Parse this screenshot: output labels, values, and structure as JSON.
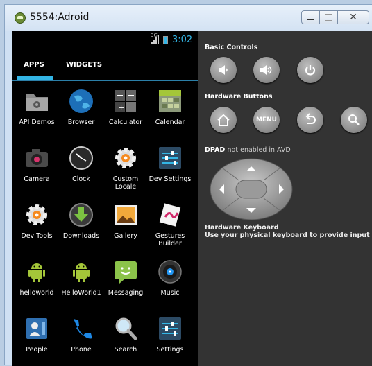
{
  "window": {
    "title": "5554:Adroid",
    "title_icon": "android-emulator-icon"
  },
  "statusbar": {
    "network": "3G",
    "time": "3:02",
    "accent": "#33b5e5"
  },
  "tabs": {
    "apps": "APPS",
    "widgets": "WIDGETS"
  },
  "apps": [
    {
      "label": "API Demos",
      "icon": "folder-gear-icon"
    },
    {
      "label": "Browser",
      "icon": "globe-icon"
    },
    {
      "label": "Calculator",
      "icon": "calculator-icon"
    },
    {
      "label": "Calendar",
      "icon": "calendar-icon"
    },
    {
      "label": "Camera",
      "icon": "camera-icon"
    },
    {
      "label": "Clock",
      "icon": "clock-icon"
    },
    {
      "label": "Custom Locale",
      "icon": "gear-icon"
    },
    {
      "label": "Dev Settings",
      "icon": "sliders-icon"
    },
    {
      "label": "Dev Tools",
      "icon": "gear-icon"
    },
    {
      "label": "Downloads",
      "icon": "download-icon"
    },
    {
      "label": "Gallery",
      "icon": "gallery-icon"
    },
    {
      "label": "Gestures Builder",
      "icon": "gestures-icon"
    },
    {
      "label": "helloworld",
      "icon": "android-icon"
    },
    {
      "label": "HelloWorld1",
      "icon": "android-icon"
    },
    {
      "label": "Messaging",
      "icon": "message-icon"
    },
    {
      "label": "Music",
      "icon": "music-icon"
    },
    {
      "label": "People",
      "icon": "contacts-icon"
    },
    {
      "label": "Phone",
      "icon": "phone-icon"
    },
    {
      "label": "Search",
      "icon": "search-icon"
    },
    {
      "label": "Settings",
      "icon": "sliders-icon"
    }
  ],
  "panel": {
    "basic_controls": "Basic Controls",
    "hardware_buttons": "Hardware Buttons",
    "menu_label": "MENU",
    "dpad_title": "DPAD",
    "dpad_note": "not enabled in AVD",
    "keyboard_title": "Hardware Keyboard",
    "keyboard_note": "Use your physical keyboard to provide input"
  }
}
